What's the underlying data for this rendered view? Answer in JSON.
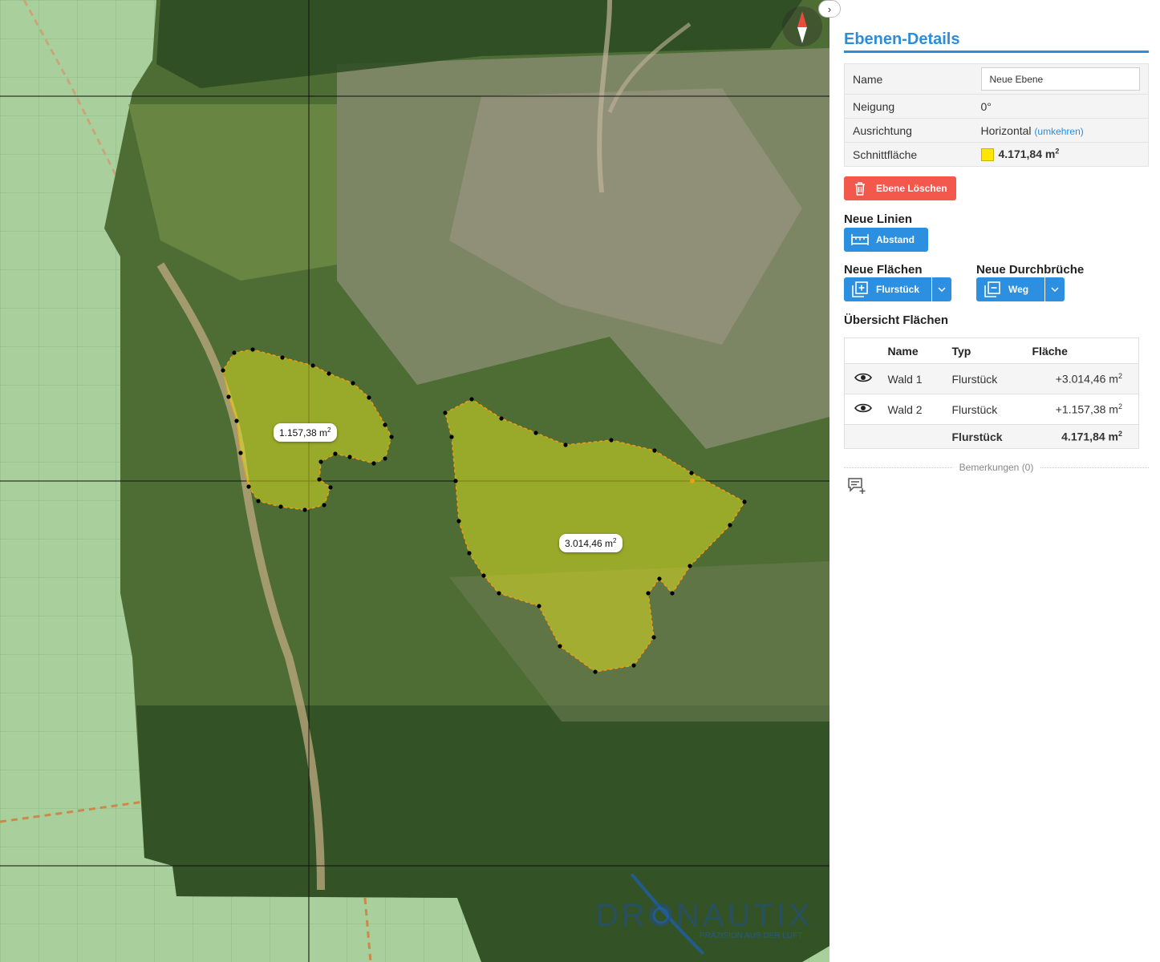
{
  "map": {
    "area_labels": [
      {
        "id": "wald-2",
        "text": "1.157,38 m",
        "sup": "2"
      },
      {
        "id": "wald-1",
        "text": "3.014,46 m",
        "sup": "2"
      }
    ],
    "logo": {
      "brand": "DRONAUTIX",
      "tagline": "PRÄZISION AUS DER LUFT"
    },
    "colors": {
      "base_map": "#a9cf9d",
      "polygon_fill": "#e6e61e",
      "polygon_stroke": "#f39c12"
    }
  },
  "panel": {
    "title": "Ebenen-Details",
    "properties": {
      "name_label": "Name",
      "name_value": "Neue Ebene",
      "tilt_label": "Neigung",
      "tilt_value": "0°",
      "orientation_label": "Ausrichtung",
      "orientation_value": "Horizontal",
      "orientation_link": "(umkehren)",
      "section_label": "Schnittfläche",
      "section_value": "4.171,84 m",
      "section_unit_sup": "2",
      "swatch_color": "#ffe600"
    },
    "delete_button": "Ebene Löschen",
    "new_lines": {
      "heading": "Neue Linien",
      "button": "Abstand"
    },
    "new_areas": {
      "heading": "Neue Flächen",
      "button": "Flurstück"
    },
    "new_openings": {
      "heading": "Neue Durchbrüche",
      "button": "Weg"
    },
    "overview": {
      "heading": "Übersicht Flächen",
      "columns": {
        "name": "Name",
        "type": "Typ",
        "area": "Fläche"
      },
      "rows": [
        {
          "name": "Wald 1",
          "type": "Flurstück",
          "area": "+3.014,46 m",
          "sup": "2"
        },
        {
          "name": "Wald 2",
          "type": "Flurstück",
          "area": "+1.157,38 m",
          "sup": "2"
        }
      ],
      "total": {
        "type": "Flurstück",
        "area": "4.171,84 m",
        "sup": "2"
      }
    },
    "remarks": "Bemerkungen (0)",
    "accent_color": "#2e8ddb",
    "danger_color": "#f2584c"
  }
}
